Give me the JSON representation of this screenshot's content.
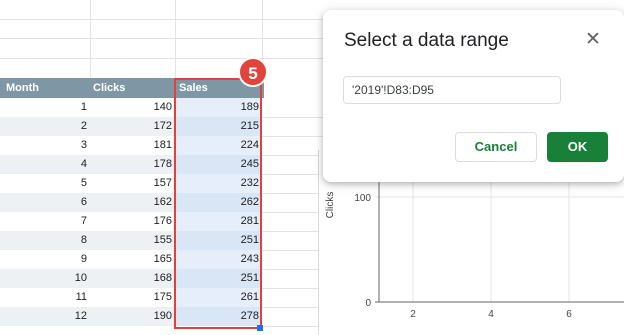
{
  "sheet": {
    "headers": {
      "month": "Month",
      "clicks": "Clicks",
      "sales": "Sales"
    },
    "rows": [
      {
        "month": "1",
        "clicks": "140",
        "sales": "189"
      },
      {
        "month": "2",
        "clicks": "172",
        "sales": "215"
      },
      {
        "month": "3",
        "clicks": "181",
        "sales": "224"
      },
      {
        "month": "4",
        "clicks": "178",
        "sales": "245"
      },
      {
        "month": "5",
        "clicks": "157",
        "sales": "232"
      },
      {
        "month": "6",
        "clicks": "162",
        "sales": "262"
      },
      {
        "month": "7",
        "clicks": "176",
        "sales": "281"
      },
      {
        "month": "8",
        "clicks": "155",
        "sales": "251"
      },
      {
        "month": "9",
        "clicks": "165",
        "sales": "243"
      },
      {
        "month": "10",
        "clicks": "168",
        "sales": "251"
      },
      {
        "month": "11",
        "clicks": "175",
        "sales": "261"
      },
      {
        "month": "12",
        "clicks": "190",
        "sales": "278"
      }
    ],
    "step_badge": "5",
    "header_color": "#7f97a5",
    "selection_color": "#e2403f"
  },
  "dialog": {
    "title": "Select a data range",
    "range_value": "'2019'!D83:D95",
    "cancel_label": "Cancel",
    "ok_label": "OK",
    "accent_color": "#188038",
    "close_icon": "close-icon"
  },
  "chart_data": {
    "type": "scatter",
    "ylabel": "Clicks",
    "xlabel": "",
    "y_ticks": [
      "0",
      "100"
    ],
    "x_ticks": [
      "2",
      "4",
      "6"
    ],
    "ylim": [
      0,
      100
    ],
    "grid": true,
    "series": []
  }
}
